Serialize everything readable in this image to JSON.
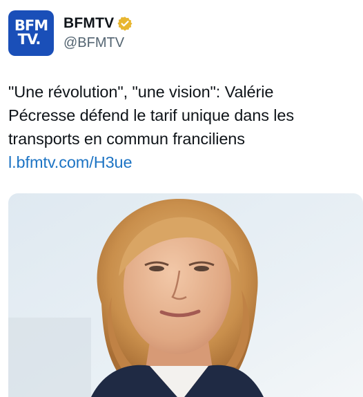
{
  "account": {
    "avatar_line1": "BFM",
    "avatar_line2": "TV.",
    "display_name": "BFMTV",
    "handle": "@BFMTV",
    "verified_icon": "verified-gold-badge-icon",
    "avatar_color": "#1a4fb8",
    "verified_color": "#e8b630"
  },
  "tweet": {
    "text_line1": "\"Une révolution\", \"une vision\": Valérie",
    "text_line2": "Pécresse défend le tarif unique dans les",
    "text_line3": "transports en commun franciliens",
    "link": "l.bfmtv.com/H3ue",
    "link_color": "#1d74c4"
  },
  "media": {
    "type": "photo"
  }
}
